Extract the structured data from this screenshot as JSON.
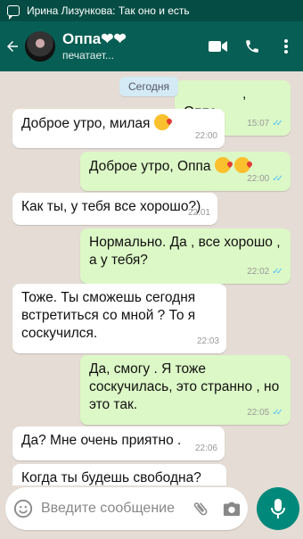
{
  "status_bar": {
    "notification": "Ирина Лизункова: Так оно и есть"
  },
  "header": {
    "contact_name": "Оппа❤❤",
    "status": "печатает..."
  },
  "date_divider": "Сегодня",
  "messages": [
    {
      "direction": "out",
      "text": ", Оппа.",
      "time": "15:07"
    },
    {
      "direction": "in",
      "text": "Доброе утро, милая",
      "time": "22:00"
    },
    {
      "direction": "out",
      "text": "Доброе утро,  Оппа",
      "time": "22:00"
    },
    {
      "direction": "in",
      "text": "Как ты,  у тебя все хорошо?)",
      "time": "22:01"
    },
    {
      "direction": "out",
      "text": "Нормально. Да , все хорошо , а у тебя?",
      "time": "22:02"
    },
    {
      "direction": "in",
      "text": "Тоже. Ты сможешь сегодня встретиться со мной ? То я соскучился.",
      "time": "22:03"
    },
    {
      "direction": "out",
      "text": "Да,  смогу . Я тоже соскучилась, это странно , но это так.",
      "time": "22:05"
    },
    {
      "direction": "in",
      "text": "Да?  Мне очень приятно .",
      "time": "22:06"
    },
    {
      "direction": "in",
      "text": "Когда ты будешь свободна?",
      "time": ""
    }
  ],
  "composer": {
    "placeholder": "Введите сообщение"
  },
  "icons": {
    "back": "arrow-back-icon",
    "video": "video-call-icon",
    "phone": "phone-icon",
    "menu": "more-vert-icon",
    "emoji": "emoji-icon",
    "attach": "paperclip-icon",
    "camera": "camera-icon",
    "mic": "microphone-icon"
  },
  "colors": {
    "header": "#075e54",
    "outgoing": "#dcf8c6",
    "incoming": "#ffffff",
    "read_ticks": "#4fc3f7",
    "fab": "#00897b"
  }
}
